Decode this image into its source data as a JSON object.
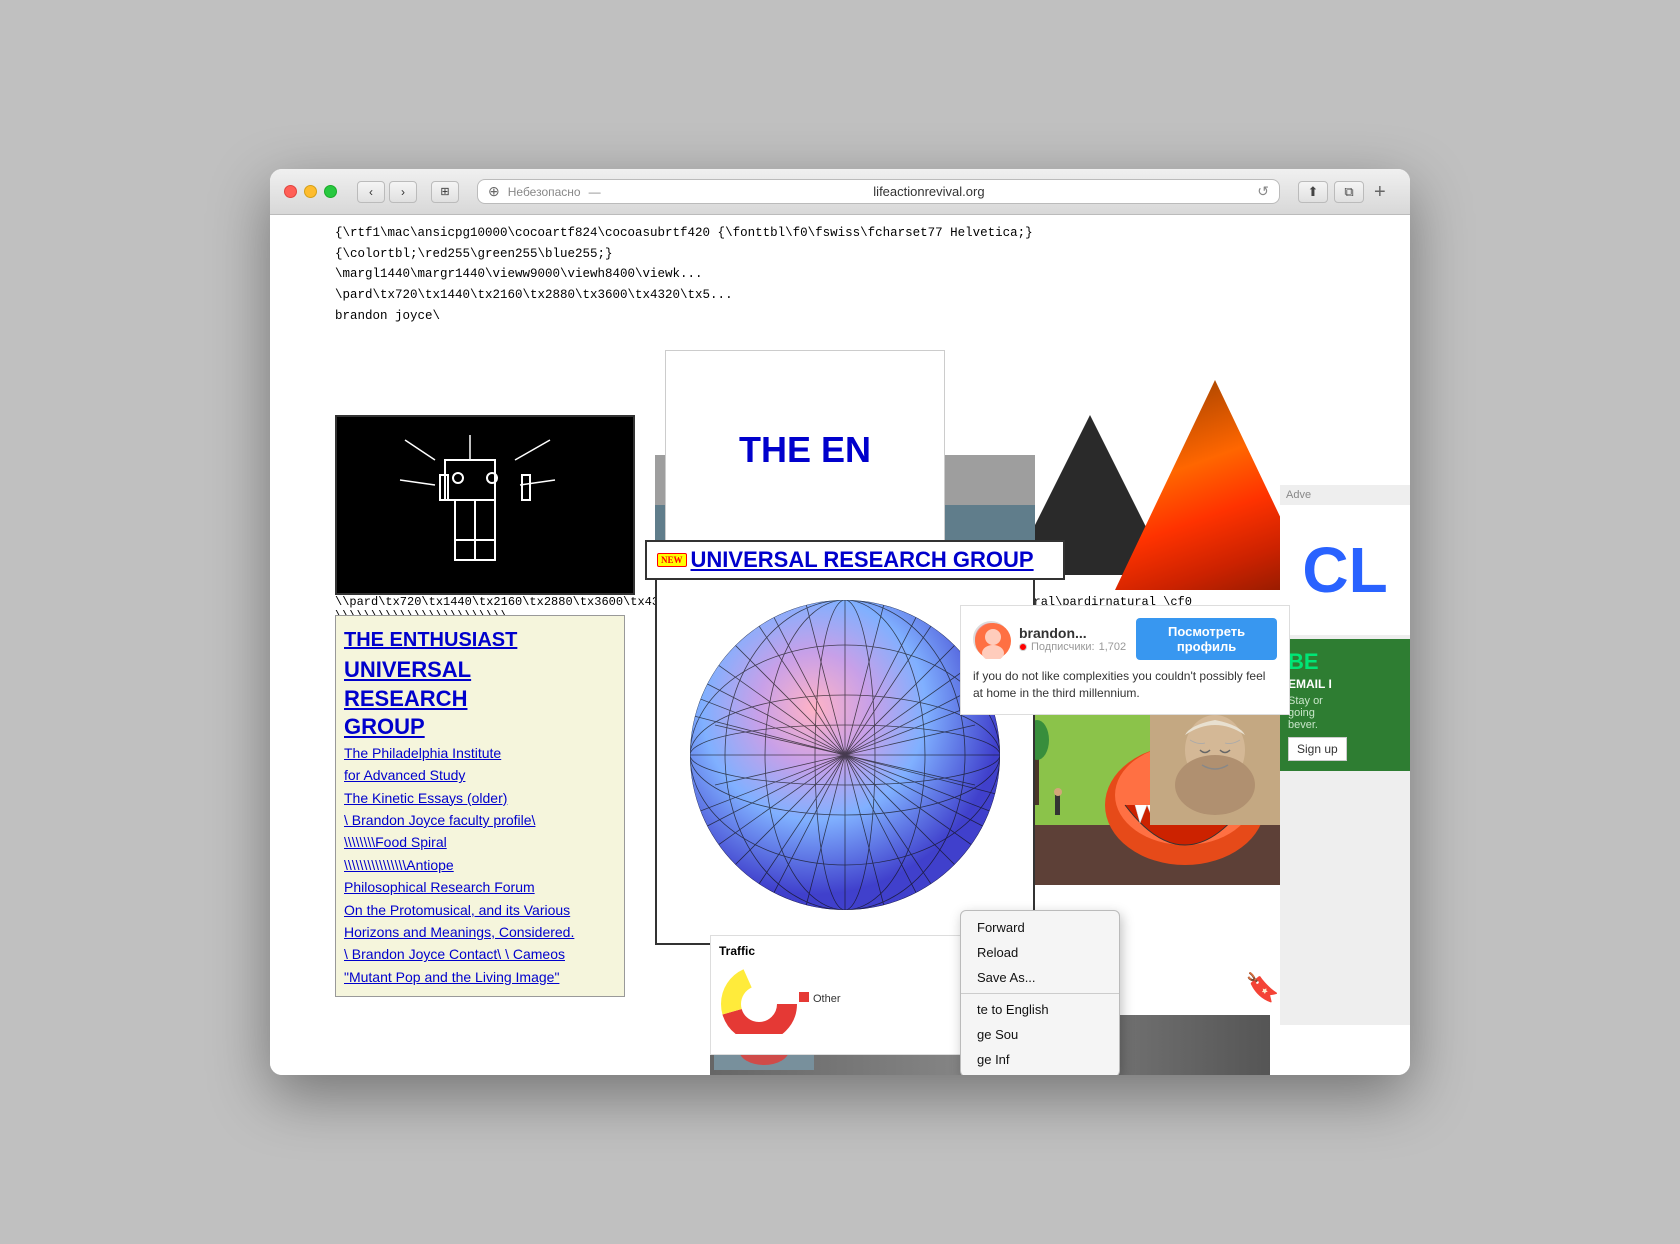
{
  "window": {
    "title": "lifeactionrevival.org",
    "security_label": "Небезопасно",
    "url": "lifeactionrevival.org",
    "address_placeholder": "Небезопасно — lifeactionrevival.org"
  },
  "nav": {
    "back": "‹",
    "forward": "›",
    "sidebar": "⊞",
    "plus": "⊕",
    "reload": "↺",
    "share": "⬆",
    "new_tab": "+"
  },
  "rtf": {
    "line1": "{\\rtf1\\mac\\ansicpg10000\\cocoartf824\\cocoasubrtf420 {\\fonttbl\\f0\\fswiss\\fcharset77 Helvetica;} {\\colortbl;\\red255\\green255\\blue255;}",
    "line2": "\\margl1440\\margr1440\\vieww9000\\viewh8400\\viewk...",
    "line3": "\\pard\\tx720\\tx1440\\tx2160\\tx2880\\tx3600\\tx4320\\tx5...",
    "line4": "brandon joyce\\",
    "line5a": "\\\\pard\\tx720\\tx1440\\tx2160\\tx2880\\tx3600\\tx4320\\tx540\\tx5760\\tx6480\\tx7200\\tx7920\\tx8640\\ql\\qnatural\\pardirnatural \\cf0 \\\\\\\\\\\\\\\\\\\\\\\\\\\\\\\\\\\\\\\\\\\\\\\\",
    "line6": "\\\\pard\\tx720\\tx1440\\tx2160\\tx2880\\tx3600\\tx4320\\tx5...",
    "line6b": "...tx28"
  },
  "sidebar": {
    "main_title": "THE ENTHUSIAST",
    "research_group": "UNIVERSAL RESEARCH GROUP",
    "links": [
      "The Philadelphia Institute for Advanced Study",
      "The Kinetic Essays (older)",
      "\\ Brandon Joyce faculty profile\\",
      "\\\\\\\\\\\\\\\\Food Spiral",
      "\\\\\\\\\\\\\\\\\\\\\\\\\\\\\\\\Antiope",
      "Philosophical Research Forum",
      "On the Protomusical, and its Various Horizons and Meanings, Considered.",
      "\\ Brandon Joyce Contact\\ \\ Cameos",
      "\"Mutant Pop and the Living Image\""
    ]
  },
  "enthusiast_panel": {
    "title": "THE EN",
    "full_title": "THE ENTHUSIAST"
  },
  "urg": {
    "badge": "NEW",
    "title": "UNIVERSAL RESEARCH GROUP"
  },
  "profile": {
    "name": "brandon...",
    "subscribers_label": "Подписчики:",
    "subscribers_count": "1,702",
    "follow_btn": "Посмотреть профиль",
    "text": "if you do not like complexities you couldn't possibly feel at home in the third millennium."
  },
  "context_menu": {
    "items": [
      "Forward",
      "Reload",
      "Save As...",
      "te to English",
      "ge Sou",
      "ge Inf"
    ]
  },
  "ad": {
    "header": "Adve",
    "cla_text": "CL",
    "bev_title": "BE",
    "bev_line1": "EMAIL I",
    "bev_line2": "Stay or",
    "bev_line3": "going",
    "bev_line4": "bever.",
    "signup": "Sign up"
  },
  "traffic": {
    "title": "Traffic",
    "legend": "Other",
    "color": "#e53935"
  }
}
